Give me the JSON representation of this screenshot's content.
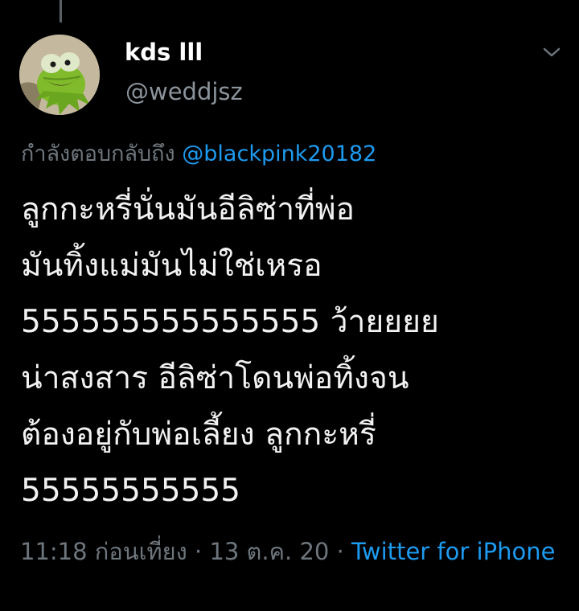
{
  "author": {
    "name": "kds lll",
    "handle": "@weddjsz",
    "avatar_icon": "kermit-frog-avatar"
  },
  "reply": {
    "prefix": "กำลังตอบกลับถึง",
    "mention": "@blackpink20182"
  },
  "tweet": {
    "lines": [
      "ลูกกะหรี่นั่นมันอีลิซ่าที่พ่อ",
      "มันทิ้งแม่มันไม่ใช่เหรอ",
      "555555555555555 ว้ายยยย",
      "น่าสงสาร อีลิซ่าโดนพ่อทิ้งจน",
      "ต้องอยู่กับพ่อเลี้ยง ลูกกะหรี่",
      "55555555555"
    ]
  },
  "meta": {
    "time": "11:18 ก่อนเที่ยง",
    "separator": " · ",
    "date": "13 ต.ค. 20",
    "source": "Twitter for iPhone"
  },
  "icons": {
    "more": "chevron-down-icon"
  },
  "colors": {
    "background": "#000000",
    "text": "#f2f2f2",
    "muted": "#6e767d",
    "link": "#1d9bf0"
  }
}
